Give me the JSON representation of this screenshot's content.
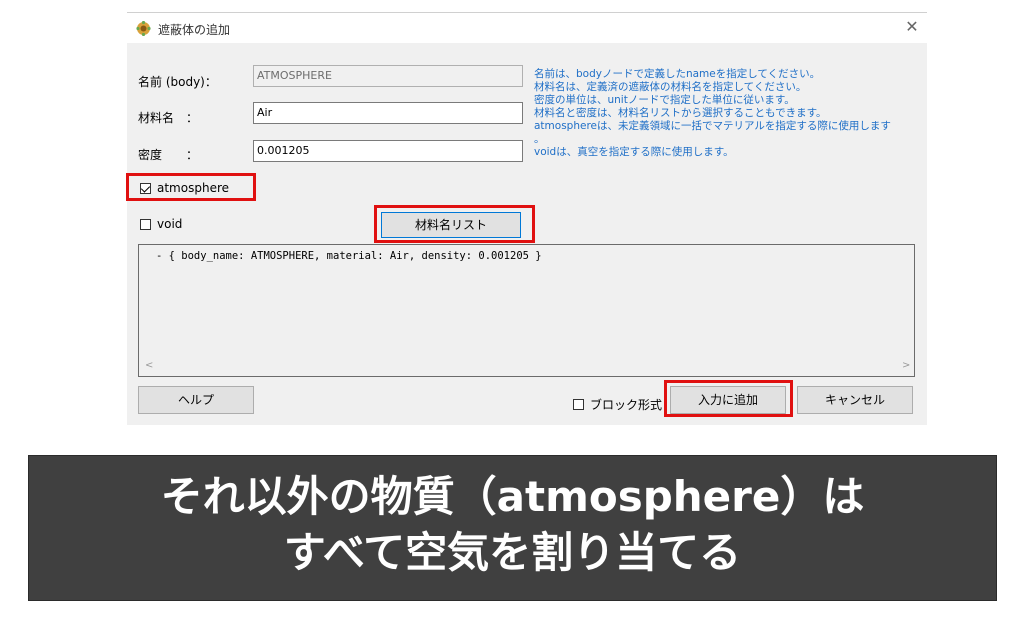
{
  "dialog": {
    "title": "遮蔽体の追加",
    "close_label": "✕",
    "name_label": "名前 (body)：",
    "name_value": "ATMOSPHERE",
    "material_label": "材料名　：",
    "material_value": "Air",
    "density_label": "密度　　：",
    "density_value": "0.001205",
    "help_lines": [
      "名前は、bodyノードで定義したnameを指定してください。",
      "材料名は、定義済の遮蔽体の材料名を指定してください。",
      "密度の単位は、unitノードで指定した単位に従います。",
      "材料名と密度は、材料名リストから選択することもできます。",
      "atmosphereは、未定義領域に一括でマテリアルを指定する際に使用します",
      "。",
      "voidは、真空を指定する際に使用します。"
    ],
    "atmosphere_label": "atmosphere",
    "atmosphere_checked": true,
    "void_label": "void",
    "void_checked": false,
    "material_list_button": "材料名リスト",
    "output_text": "- { body_name: ATMOSPHERE, material: Air, density: 0.001205 }",
    "help_button": "ヘルプ",
    "block_format_label": "ブロック形式",
    "block_format_checked": false,
    "add_button": "入力に追加",
    "cancel_button": "キャンセル",
    "highlight_color": "#e01010"
  },
  "banner": {
    "line1": "それ以外の物質（atmosphere）は",
    "line2": "すべて空気を割り当てる"
  }
}
